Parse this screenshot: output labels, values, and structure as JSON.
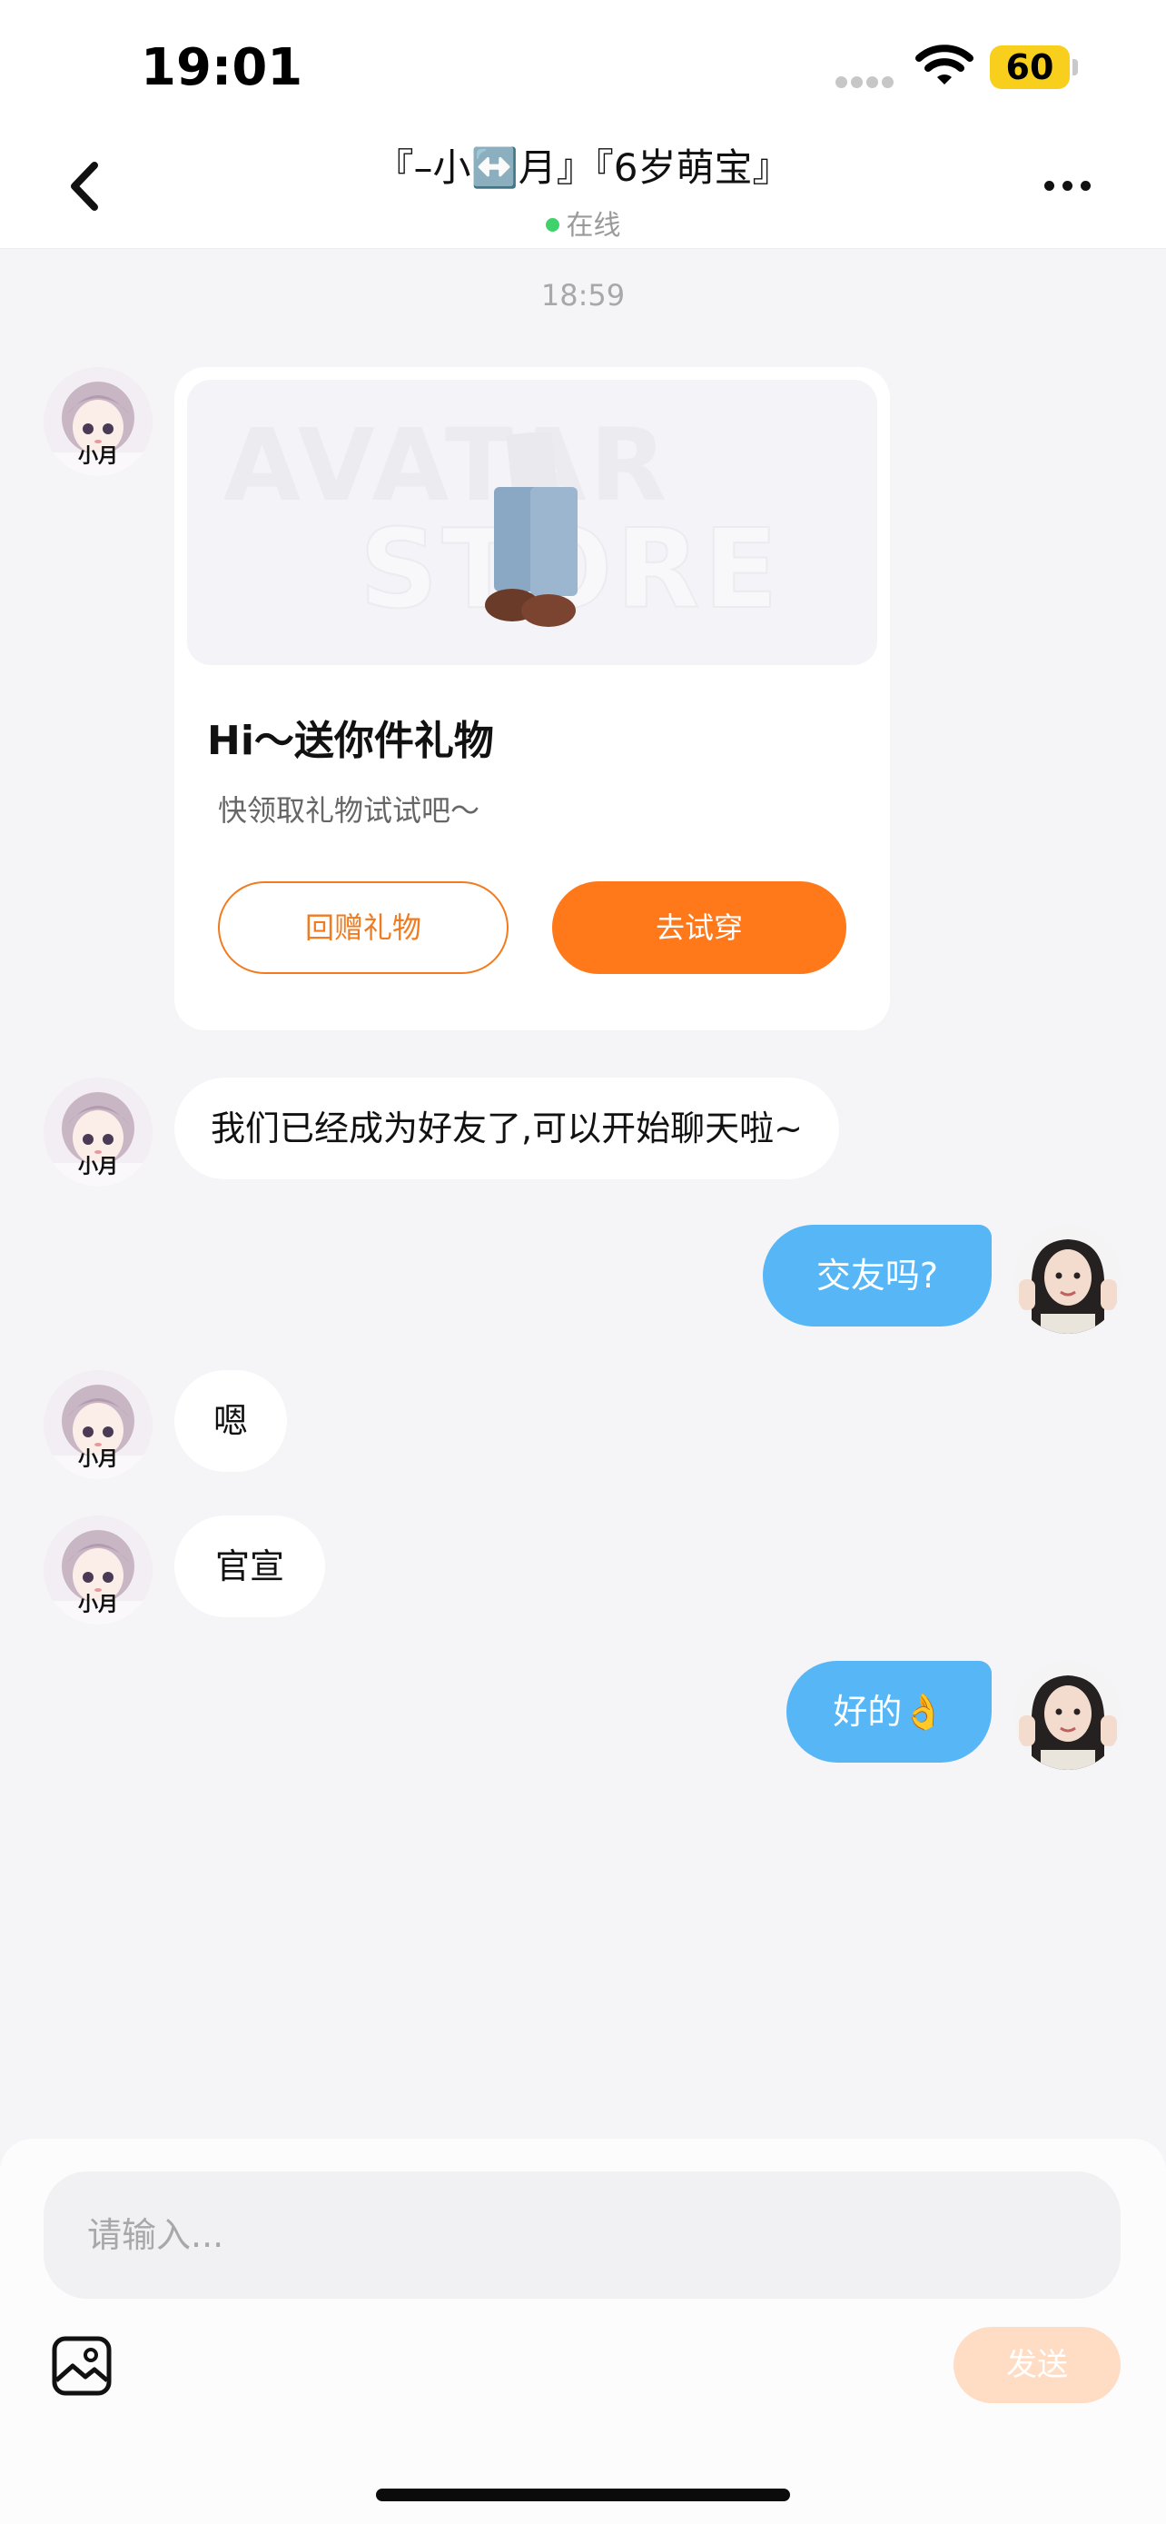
{
  "status_bar": {
    "time": "19:01",
    "battery": "60",
    "wifi_icon": "wifi-icon",
    "signal_icon": "signal-icon"
  },
  "header": {
    "title": "『–小↔️月』『6岁萌宝』",
    "status": "在线",
    "back_icon": "chevron-left-icon",
    "more_icon": "more-horizontal-icon"
  },
  "chat": {
    "timestamp": "18:59",
    "gift_card": {
      "title": "Hi～送你件礼物",
      "subtitle": "快领取礼物试试吧～",
      "watermark_line1": "AVATAR",
      "watermark_line2": "STORE",
      "return_gift_label": "回赠礼物",
      "try_on_label": "去试穿"
    },
    "messages": [
      {
        "side": "left",
        "avatar_badge": "小月",
        "text": "我们已经成为好友了,可以开始聊天啦~"
      },
      {
        "side": "right",
        "text": "交友吗?"
      },
      {
        "side": "left",
        "avatar_badge": "小月",
        "text": "嗯"
      },
      {
        "side": "left",
        "avatar_badge": "小月",
        "text": "官宣"
      },
      {
        "side": "right",
        "text": "好的👌"
      }
    ]
  },
  "composer": {
    "placeholder": "请输入...",
    "value": "",
    "send_label": "发送",
    "image_icon": "image-icon"
  },
  "colors": {
    "accent_orange": "#ff7819",
    "bubble_blue": "#57b6f6",
    "online_green": "#3fd26b",
    "send_disabled": "#ffddc4",
    "background": "#f5f4f6"
  }
}
